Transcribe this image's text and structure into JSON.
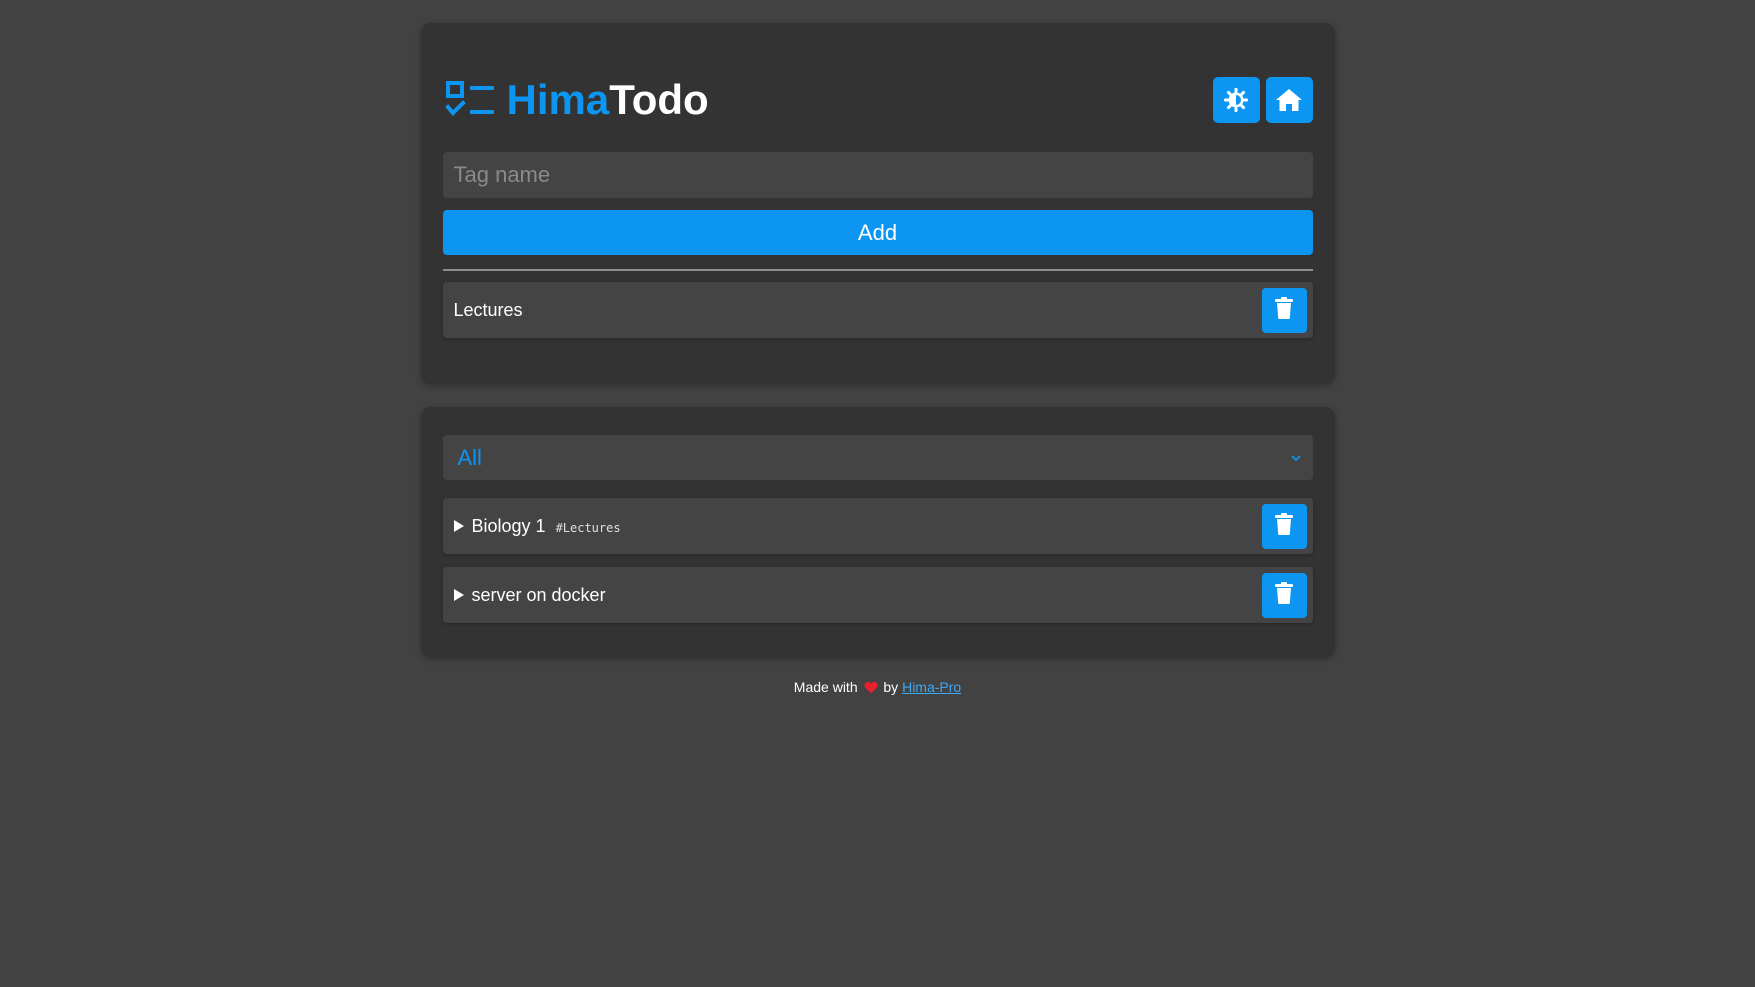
{
  "header": {
    "title_accent": "Hima",
    "title_rest": "Todo",
    "logo_icon": "checklist-icon",
    "theme_button_icon": "brightness-icon",
    "home_button_icon": "home-icon"
  },
  "tag_form": {
    "input_placeholder": "Tag name",
    "input_value": "",
    "add_label": "Add"
  },
  "tags": [
    {
      "label": "Lectures",
      "delete_icon": "trash-icon"
    }
  ],
  "filter": {
    "selected": "All",
    "icon": "chevron-down-icon"
  },
  "todos": [
    {
      "title": "Biology 1",
      "tag": "#Lectures",
      "expanded": false
    },
    {
      "title": "server on docker",
      "tag": "",
      "expanded": false
    }
  ],
  "footer": {
    "made_with": "Made with",
    "by": "by",
    "author_link": "Hima-Pro",
    "heart_icon": "heart-icon"
  },
  "colors": {
    "background": "#424242",
    "card": "#333333",
    "row": "#444444",
    "accent": "#0c96f2",
    "heart": "#e5212b"
  }
}
